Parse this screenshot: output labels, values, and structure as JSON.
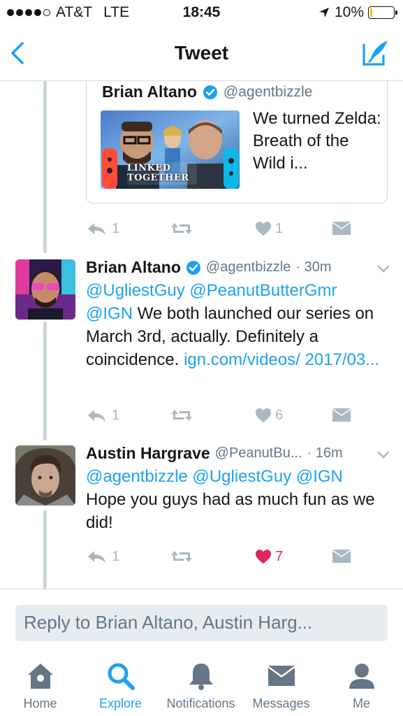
{
  "status_bar": {
    "carrier": "AT&T",
    "network": "LTE",
    "time": "18:45",
    "battery": "10%",
    "battery_level": 0.1,
    "battery_color": "#f2c200"
  },
  "nav": {
    "title": "Tweet",
    "back_icon": "chevron-left-icon",
    "compose_icon": "compose-icon"
  },
  "quoted_tweet": {
    "name": "Brian Altano",
    "handle": "@agentbizzle",
    "text": "We turned Zelda: Breath of the Wild i...",
    "thumbnail_text": "LINKED TOGETHER",
    "actions": {
      "replies": "1",
      "retweets": "",
      "likes": "1"
    }
  },
  "tweets": [
    {
      "name": "Brian Altano",
      "handle": "@agentbizzle",
      "time": "· 30m",
      "verified": true,
      "segments": [
        {
          "text": "@UgliestGuy @PeanutButterGmr @IGN",
          "link": true
        },
        {
          "text": " We both launched our series on March 3rd, actually. Definitely a coincidence. ",
          "link": false
        },
        {
          "text": "ign.com/videos/ 2017/03...",
          "link": true
        }
      ],
      "actions": {
        "replies": "1",
        "retweets": "",
        "likes": "6",
        "liked": false
      }
    },
    {
      "name": "Austin Hargrave",
      "handle": "@PeanutBu...",
      "time": "· 16m",
      "verified": false,
      "segments": [
        {
          "text": "@agentbizzle @UgliestGuy @IGN",
          "link": true
        },
        {
          "text": " Hope you guys had as much fun as we did!",
          "link": false
        }
      ],
      "actions": {
        "replies": "1",
        "retweets": "",
        "likes": "7",
        "liked": true
      }
    }
  ],
  "reply": {
    "placeholder": "Reply to Brian Altano, Austin Harg..."
  },
  "tabs": [
    {
      "label": "Home",
      "icon": "home-icon",
      "active": false
    },
    {
      "label": "Explore",
      "icon": "search-icon",
      "active": true
    },
    {
      "label": "Notifications",
      "icon": "bell-icon",
      "active": false
    },
    {
      "label": "Messages",
      "icon": "envelope-icon",
      "active": false
    },
    {
      "label": "Me",
      "icon": "person-icon",
      "active": false
    }
  ],
  "colors": {
    "accent": "#1da1f2",
    "like": "#e0245e",
    "muted": "#aab8c2",
    "text_secondary": "#657786"
  }
}
